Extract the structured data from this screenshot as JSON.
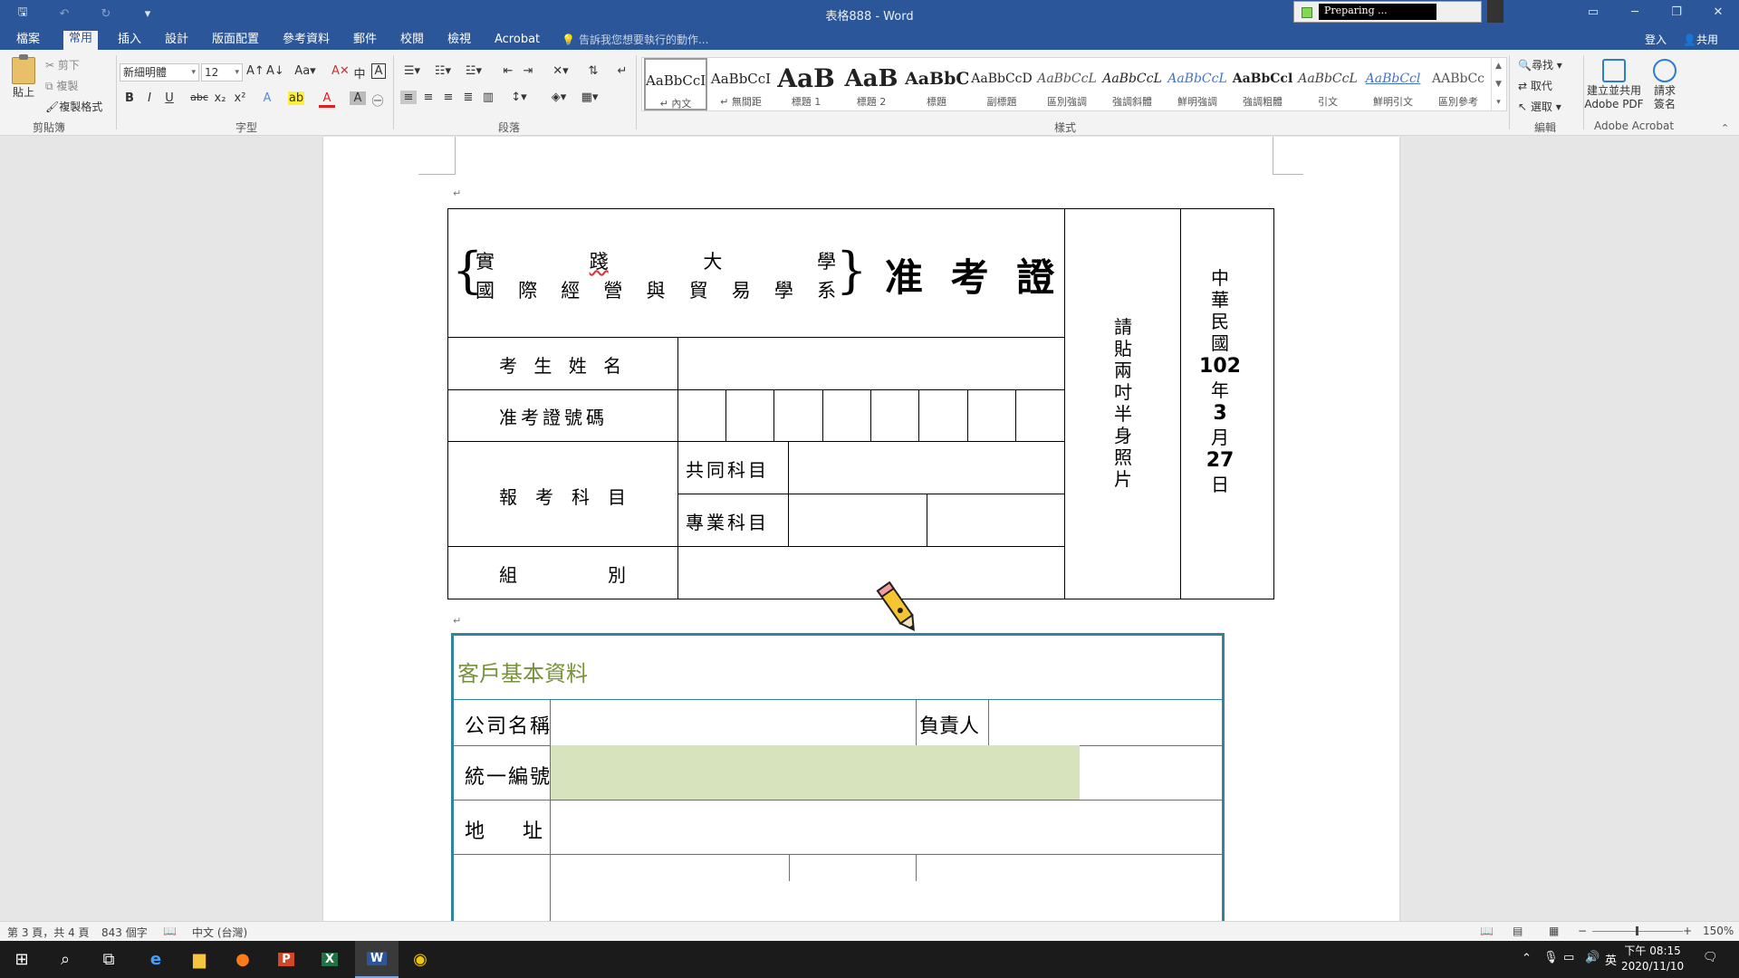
{
  "window": {
    "title": "表格888 - Word",
    "preparing": "Preparing ...",
    "qa_save_icon": "save-icon",
    "qa_undo_icon": "undo-icon",
    "qa_redo_icon": "redo-icon",
    "qa_customize_icon": "customize-icon"
  },
  "tabs": [
    "檔案",
    "常用",
    "插入",
    "設計",
    "版面配置",
    "參考資料",
    "郵件",
    "校閱",
    "檢視",
    "Acrobat"
  ],
  "active_tab": "常用",
  "tell_me": "告訴我您想要執行的動作...",
  "account": {
    "signin": "登入",
    "share": "共用"
  },
  "ribbon": {
    "clipboard": {
      "paste": "貼上",
      "cut": "剪下",
      "copy": "複製",
      "format_painter": "複製格式",
      "label": "剪貼簿"
    },
    "font": {
      "name": "新細明體",
      "size": "12",
      "label": "字型"
    },
    "paragraph": {
      "label": "段落"
    },
    "styles": {
      "label": "樣式",
      "items": [
        {
          "sample": "AaBbCcI",
          "name": "↵ 內文"
        },
        {
          "sample": "AaBbCcI",
          "name": "↵ 無間距"
        },
        {
          "sample": "AaB",
          "name": "標題 1"
        },
        {
          "sample": "AaB",
          "name": "標題 2"
        },
        {
          "sample": "AaBbC",
          "name": "標題"
        },
        {
          "sample": "AaBbCcD",
          "name": "副標題"
        },
        {
          "sample": "AaBbCcL",
          "name": "區別強調"
        },
        {
          "sample": "AaBbCcL",
          "name": "強調斜體"
        },
        {
          "sample": "AaBbCcL",
          "name": "鮮明強調"
        },
        {
          "sample": "AaBbCcl",
          "name": "強調粗體"
        },
        {
          "sample": "AaBbCcL",
          "name": "引文"
        },
        {
          "sample": "AaBbCcl",
          "name": "鮮明引文"
        },
        {
          "sample": "AABbCc",
          "name": "區別參考"
        }
      ]
    },
    "editing": {
      "find": "尋找",
      "replace": "取代",
      "select": "選取",
      "label": "編輯"
    },
    "adobe": {
      "create": "建立並共用",
      "create2": "Adobe PDF",
      "request": "請求",
      "request2": "簽名",
      "label": "Adobe Acrobat"
    }
  },
  "exam_card": {
    "school": [
      "實",
      "踐",
      "大",
      "學"
    ],
    "dept": [
      "國",
      "際",
      "經",
      "營",
      "與",
      "貿",
      "易",
      "學",
      "系"
    ],
    "title": "准 考 證",
    "name_label": "考 生 姓 名",
    "number_label": "准考證號碼",
    "subject_label": [
      "報",
      "考",
      "科",
      "目"
    ],
    "common_subject": "共同科目",
    "major_subject": "專業科目",
    "group_label": [
      "組",
      "別"
    ],
    "photo": [
      "請",
      "貼",
      "兩",
      "吋",
      "半",
      "身",
      "照",
      "片"
    ],
    "date": {
      "era": [
        "中",
        "華",
        "民",
        "國"
      ],
      "year": "102",
      "y": "年",
      "month": "3",
      "m": "月",
      "day": "27",
      "d": "日"
    }
  },
  "client_form": {
    "title": "客戶基本資料",
    "company": "公司名稱",
    "owner": "負責人",
    "tax_id": "統一編號",
    "address": [
      "地",
      "址"
    ]
  },
  "status": {
    "page": "第 3 頁，共 4 頁",
    "words": "843 個字",
    "language": "中文 (台灣)",
    "zoom": "150%"
  },
  "taskbar": {
    "time": "下午 08:15",
    "date": "2020/11/10",
    "ime": "英"
  }
}
